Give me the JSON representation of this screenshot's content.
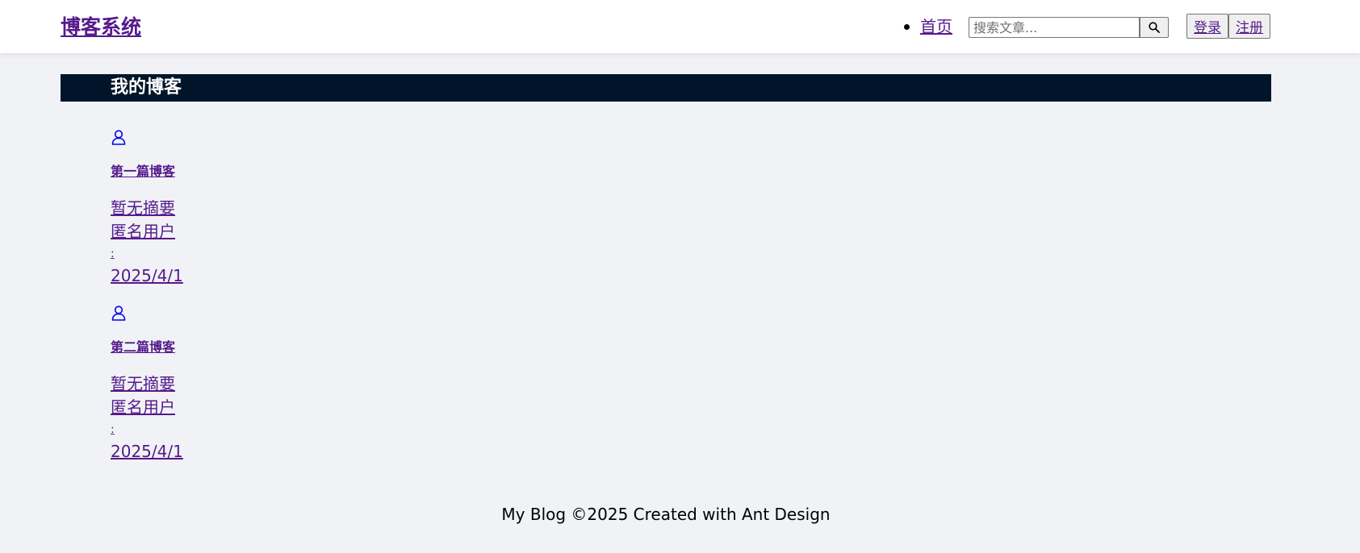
{
  "header": {
    "logo": "博客系统",
    "nav_items": [
      "首页"
    ],
    "search": {
      "placeholder": "搜索文章..."
    },
    "login_label": "登录",
    "register_label": "注册"
  },
  "page": {
    "title": "我的博客"
  },
  "posts": [
    {
      "title": "第一篇博客",
      "summary": "暂无摘要",
      "author": "匿名用户",
      "separator": ":",
      "date": "2025/4/1"
    },
    {
      "title": "第二篇博客",
      "summary": "暂无摘要",
      "author": "匿名用户",
      "separator": ":",
      "date": "2025/4/1"
    }
  ],
  "icons": {
    "search": "search-icon",
    "avatar": "user-icon"
  },
  "colors": {
    "header_band": "#001529",
    "icon": "#0000ee",
    "link_visited": "#551a8b",
    "background": "#f0f2f5"
  },
  "footer": {
    "text": "My Blog ©2025 Created with Ant Design"
  }
}
